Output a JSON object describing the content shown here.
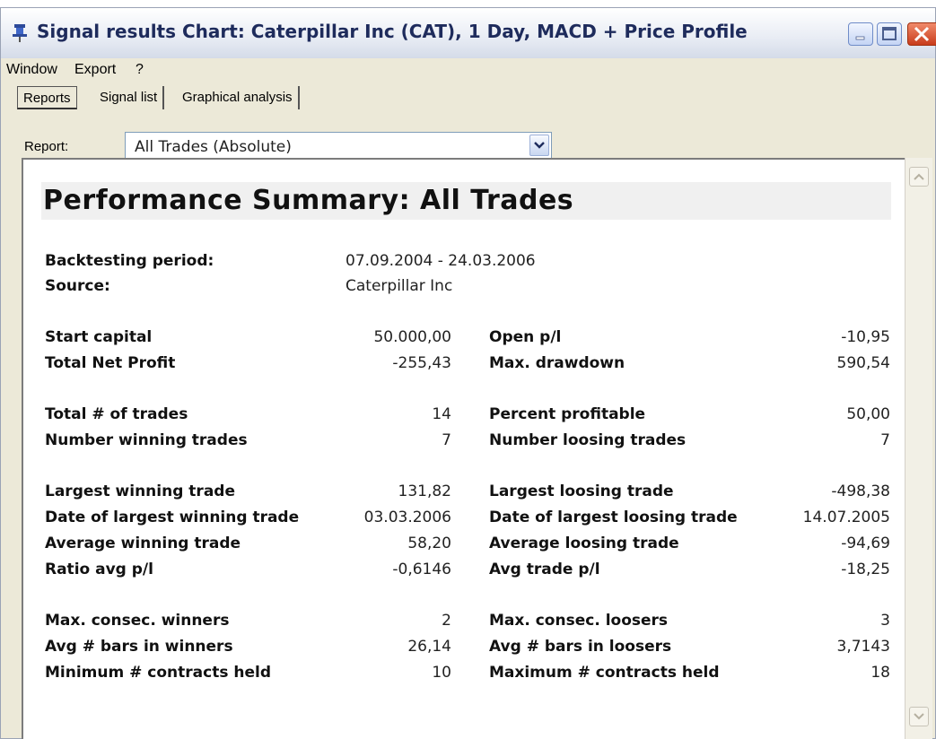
{
  "window": {
    "title": "Signal results Chart: Caterpillar Inc (CAT), 1 Day, MACD + Price Profile",
    "icon": "pin-icon"
  },
  "menu": [
    "Window",
    "Export",
    "?"
  ],
  "tabs": [
    {
      "label": "Reports",
      "active": true
    },
    {
      "label": "Signal list",
      "active": false
    },
    {
      "label": "Graphical analysis",
      "active": false
    }
  ],
  "report": {
    "label": "Report:",
    "selected": "All Trades (Absolute)"
  },
  "summary": {
    "heading": "Performance Summary: All Trades",
    "backtesting_label": "Backtesting period:",
    "backtesting_value": "07.09.2004 - 24.03.2006",
    "source_label": "Source:",
    "source_value": "Caterpillar Inc",
    "rows": [
      {
        "l1": "Start capital",
        "v1": "50.000,00",
        "l2": "Open p/l",
        "v2": "-10,95"
      },
      {
        "l1": "Total Net Profit",
        "v1": "-255,43",
        "l2": "Max. drawdown",
        "v2": "590,54"
      },
      {
        "l1": "Total # of trades",
        "v1": "14",
        "l2": "Percent profitable",
        "v2": "50,00"
      },
      {
        "l1": "Number winning trades",
        "v1": "7",
        "l2": "Number loosing trades",
        "v2": "7"
      },
      {
        "l1": "Largest winning trade",
        "v1": "131,82",
        "l2": "Largest loosing trade",
        "v2": "-498,38"
      },
      {
        "l1": "Date of largest winning trade",
        "v1": "03.03.2006",
        "l2": "Date of largest loosing trade",
        "v2": "14.07.2005"
      },
      {
        "l1": "Average winning trade",
        "v1": "58,20",
        "l2": "Average loosing trade",
        "v2": "-94,69"
      },
      {
        "l1": "Ratio avg p/l",
        "v1": "-0,6146",
        "l2": "Avg trade p/l",
        "v2": "-18,25"
      },
      {
        "l1": "Max. consec. winners",
        "v1": "2",
        "l2": "Max. consec. loosers",
        "v2": "3"
      },
      {
        "l1": "Avg # bars in winners",
        "v1": "26,14",
        "l2": "Avg # bars in loosers",
        "v2": "3,7143"
      },
      {
        "l1": "Minimum # contracts held",
        "v1": "10",
        "l2": "Maximum # contracts held",
        "v2": "18"
      }
    ]
  },
  "colors": {
    "title_text": "#1e2b5c",
    "close_button": "#c83c1c",
    "window_bg": "#ece9d8"
  }
}
